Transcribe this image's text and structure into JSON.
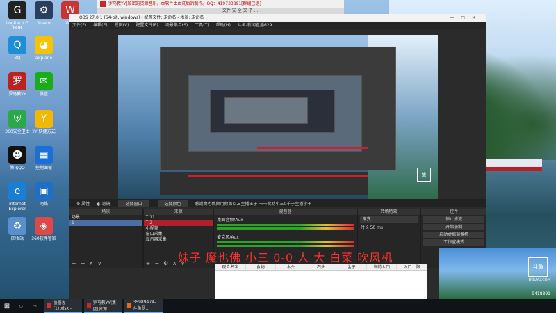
{
  "top_chrome": {
    "title": "罗马教YY|加密的资源音乐，本软件由血洗后的制作。QQ：419733891[群组已退]",
    "tabs_hint": "文件  安  全  夹  子  ..."
  },
  "desktop_icons": [
    {
      "icon": "logitech-g-icon",
      "label": "Logitech G HUB",
      "color": "#222"
    },
    {
      "icon": "steam-icon",
      "label": "Steam",
      "color": "#2a3f5f"
    },
    {
      "icon": "app-icon",
      "label": "WPS",
      "color": "#c33"
    },
    {
      "icon": "qq-icon",
      "label": "ZQ",
      "color": "#1e8fd6"
    },
    {
      "icon": "duck-icon",
      "label": "airplane",
      "color": "#f5c400"
    },
    {
      "icon": "roma-icon",
      "label": "罗马教YY",
      "color": "#b22"
    },
    {
      "icon": "wechat-icon",
      "label": "微信",
      "color": "#1aad19"
    },
    {
      "icon": "security-icon",
      "label": "360安全卫士",
      "color": "#2ba84a"
    },
    {
      "icon": "yy-icon",
      "label": "YY 快捷方式",
      "color": "#f5b800"
    },
    {
      "icon": "tencentqq-icon",
      "label": "腾讯QQ",
      "color": "#111"
    },
    {
      "icon": "control-panel-icon",
      "label": "控制面板",
      "color": "#1b6fd8"
    },
    {
      "icon": "ie-icon",
      "label": "Internet Explorer",
      "color": "#1a7ed6"
    },
    {
      "icon": "network-icon",
      "label": "网络",
      "color": "#1f6fc9"
    },
    {
      "icon": "recycle-icon",
      "label": "回收站",
      "color": "#5a8fd0"
    },
    {
      "icon": "software-icon",
      "label": "360软件管家",
      "color": "#e04747"
    }
  ],
  "obs": {
    "title": "OBS 27.0.1 (64-bit, windows) - 配置文件: 未命名 - 场景: 未命名",
    "menu": [
      "文件(F)",
      "编辑(E)",
      "视图(V)",
      "配置文件(P)",
      "场景集合(S)",
      "工具(T)",
      "帮助(H)",
      "斗鱼-新闻直播629"
    ],
    "toolbar": {
      "props": "属性",
      "filter": "滤镜",
      "select_window": "选择窗口",
      "select_audio": "选择颜色",
      "marquee": "感谢魔也佛颜用颜如以友主播王子 卡卡赞助小三0千子主播李子"
    },
    "scenes": {
      "header": "场景",
      "items": [
        "场景",
        "1"
      ]
    },
    "sources": {
      "header": "来源",
      "items": [
        "T 11",
        "T 2",
        "小视频",
        "窗口采集",
        "显示器采集"
      ]
    },
    "mixer": {
      "header": "混音器",
      "tracks": [
        "桌面音频/Aux",
        "麦克风/Aux"
      ],
      "db": [
        "0.0 dB",
        "0.0 dB"
      ]
    },
    "transitions": {
      "header": "转场特效",
      "type": "渐变",
      "duration_label": "时长",
      "duration": "50 ms"
    },
    "controls": {
      "header": "控件",
      "buttons": [
        "停止推流",
        "开始录制",
        "启动虚拟摄像机",
        "工作室模式"
      ]
    }
  },
  "overlay_text": "妹子 魔也佛 小三 0-0 人 大 白菜 吹风机",
  "table": {
    "headers": [
      "观众名字",
      "食物",
      "木头",
      "石头",
      "金子",
      "当前入口",
      "入口上限"
    ]
  },
  "douyu": {
    "logo": "斗鱼",
    "domain": "DOUYU.COM",
    "room": "9418891"
  },
  "taskbar": {
    "apps": [
      "投票表(1).xlsx -",
      "罗马教YY|集团[资源",
      "35989474-斗鱼罗..."
    ]
  }
}
